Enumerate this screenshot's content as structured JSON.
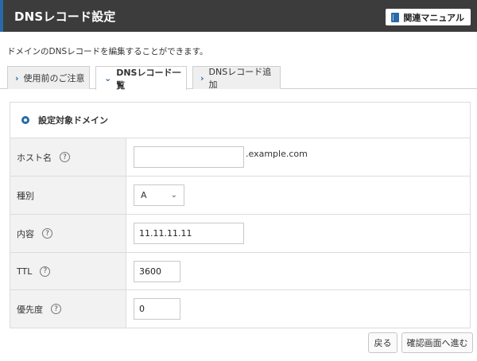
{
  "header": {
    "title": "DNSレコード設定",
    "manual_label": "関連マニュアル",
    "manual_icon": "book-icon"
  },
  "description": "ドメインのDNSレコードを編集することができます。",
  "tabs": [
    {
      "label": "使用前のご注意",
      "active": false
    },
    {
      "label": "DNSレコード一覧",
      "active": true
    },
    {
      "label": "DNSレコード追加",
      "active": false
    }
  ],
  "panel": {
    "heading": "設定対象ドメイン",
    "fields": [
      {
        "label": "ホスト名",
        "help": "?",
        "value": "",
        "suffix": ".example.com"
      },
      {
        "label": "種別",
        "value": "A"
      },
      {
        "label": "内容",
        "help": "?",
        "value": "11.11.11.11"
      },
      {
        "label": "TTL",
        "help": "?",
        "value": "3600"
      },
      {
        "label": "優先度",
        "help": "?",
        "value": "0"
      }
    ]
  },
  "buttons": {
    "back": "戻る",
    "confirm": "確認画面へ進む"
  },
  "colors": {
    "accent": "#2a69a8",
    "header_bg": "#3c3c3c"
  }
}
